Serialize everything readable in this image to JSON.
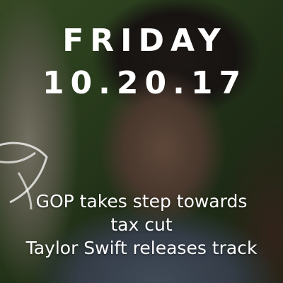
{
  "card": {
    "day": "FRIDAY",
    "date": "10.20.17",
    "headlines": [
      {
        "line1": "GOP takes step towards",
        "line2": "tax cut"
      },
      {
        "line1": "Taylor Swift releases track"
      }
    ]
  },
  "colors": {
    "text": "#ffffff",
    "overlay": "rgba(0,0,0,0.32)"
  },
  "icons": {
    "watermark": "leaf-logo-icon"
  }
}
